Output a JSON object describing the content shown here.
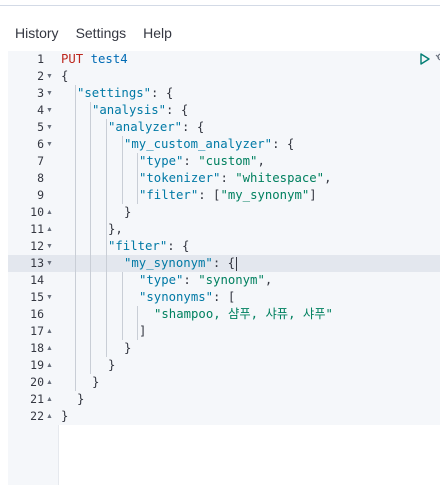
{
  "menu": {
    "history": "History",
    "settings": "Settings",
    "help": "Help"
  },
  "editor": {
    "active_line": 13,
    "line_numbers": [
      "1",
      "2",
      "3",
      "4",
      "5",
      "6",
      "7",
      "8",
      "9",
      "10",
      "11",
      "12",
      "13",
      "14",
      "15",
      "16",
      "17",
      "18",
      "19",
      "20",
      "21",
      "22"
    ],
    "request": {
      "method": "PUT",
      "url": "test4"
    },
    "code": {
      "l2": "{",
      "l3_key": "\"settings\"",
      "l3_rest": ": {",
      "l4_key": "\"analysis\"",
      "l4_rest": ": {",
      "l5_key": "\"analyzer\"",
      "l5_rest": ": {",
      "l6_key": "\"my_custom_analyzer\"",
      "l6_rest": ": {",
      "l7_key": "\"type\"",
      "l7_colon": ": ",
      "l7_val": "\"custom\"",
      "l7_end": ",",
      "l8_key": "\"tokenizer\"",
      "l8_colon": ": ",
      "l8_val": "\"whitespace\"",
      "l8_end": ",",
      "l9_key": "\"filter\"",
      "l9_colon": ": [",
      "l9_val": "\"my_synonym\"",
      "l9_end": "]",
      "l10": "}",
      "l11": "},",
      "l12_key": "\"filter\"",
      "l12_rest": ": {",
      "l13_key": "\"my_synonym\"",
      "l13_rest": ": {",
      "l14_key": "\"type\"",
      "l14_colon": ": ",
      "l14_val": "\"synonym\"",
      "l14_end": ",",
      "l15_key": "\"synonyms\"",
      "l15_rest": ": [",
      "l16_val": "\"shampoo, 샴푸, 샤퓨, 샤푸\"",
      "l17": "]",
      "l18": "}",
      "l19": "}",
      "l20": "}",
      "l21": "}",
      "l22": "}"
    }
  }
}
